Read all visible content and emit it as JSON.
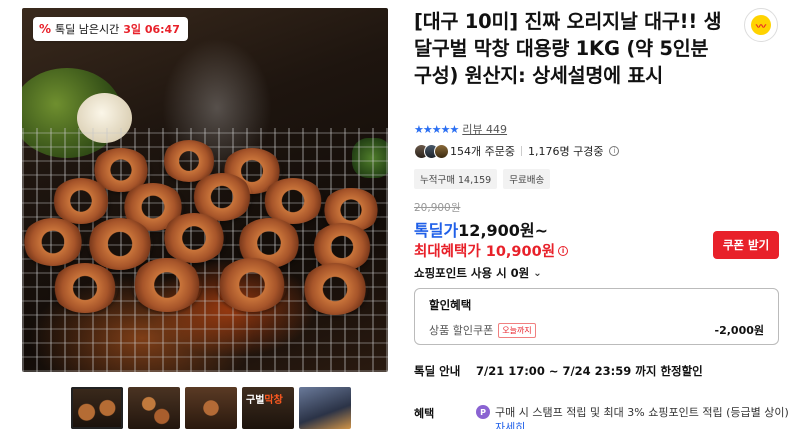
{
  "timer": {
    "icon": "discount-percent-icon",
    "label": "톡딜 남은시간",
    "time": "3일 06:47"
  },
  "product": {
    "title": "[대구 10미] 진짜 오리지날 대구!! 생 달구벌 막창 대용량 1KG (약 5인분 구성) 원산지: 상세설명에 표시",
    "rating_stars": "★★★★★",
    "review_label": "리뷰 449",
    "orders": "154개 주문중",
    "buyers": "1,176명 구경중",
    "tags": [
      "누적구매 14,159",
      "무료배송"
    ]
  },
  "thumbnails": {
    "t4_label_a": "구벌",
    "t4_label_b": "막창"
  },
  "pricing": {
    "original": "20,900원",
    "deal_label": "톡딜가",
    "deal_price": "12,900원~",
    "max_benefit": "최대혜택가 10,900원",
    "coupon_button": "쿠폰 받기",
    "points_label": "쇼핑포인트 사용 시 0원"
  },
  "benefit_box": {
    "title": "할인혜택",
    "line_label": "상품 할인쿠폰",
    "line_chip": "오늘까지",
    "line_amount": "-2,000원"
  },
  "deal_info": {
    "label": "톡딜 안내",
    "value": "7/21 17:00 ~ 7/24 23:59 까지 한정할인"
  },
  "perk": {
    "label": "혜택",
    "icon_text": "P",
    "text": "구매 시 스탬프 적립 및 최대 3% 쇼핑포인트 적립 (등급별 상이)",
    "more": "자세히"
  },
  "colors": {
    "accent_red": "#e8212a",
    "accent_blue": "#1f5fe8",
    "star_blue": "#2b6ff2",
    "brand_yellow": "#ffd300"
  }
}
